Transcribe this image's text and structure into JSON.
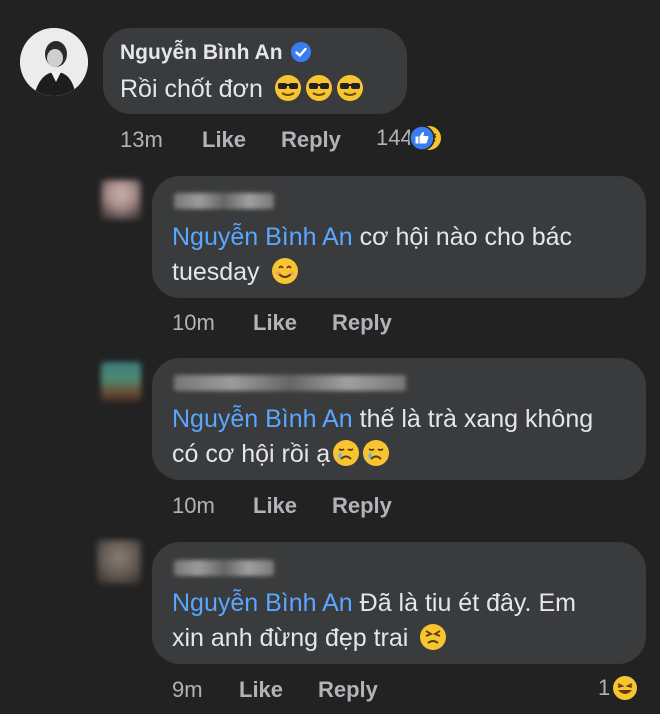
{
  "comment_main": {
    "author": "Nguyễn Bình An",
    "text": "Rồi chốt đơn",
    "time": "13m",
    "like_label": "Like",
    "reply_label": "Reply",
    "reaction_count": "144",
    "reaction_icons": [
      "laugh-emoji-icon",
      "like-thumb-icon"
    ],
    "emoji_icons": [
      "sunglasses-emoji-icon",
      "sunglasses-emoji-icon",
      "sunglasses-emoji-icon"
    ]
  },
  "replies": [
    {
      "mention": "Nguyễn Bình An",
      "text_line1": " cơ hội nào cho bác",
      "text_line2": "tuesday",
      "emoji_icons": [
        "smile-emoji-icon"
      ],
      "time": "10m",
      "like_label": "Like",
      "reply_label": "Reply"
    },
    {
      "mention": "Nguyễn Bình An",
      "text_line1": " thế là trà xang không",
      "text_line2": "có cơ hội rồi ạ",
      "emoji_icons": [
        "crying-emoji-icon",
        "crying-emoji-icon"
      ],
      "time": "10m",
      "like_label": "Like",
      "reply_label": "Reply"
    },
    {
      "mention": "Nguyễn Bình An",
      "text_line1": " Đã là tiu ét đây. Em",
      "text_line2": "xin anh đừng đẹp trai",
      "emoji_icons": [
        "tired-face-emoji-icon"
      ],
      "time": "9m",
      "like_label": "Like",
      "reply_label": "Reply",
      "reaction_count": "1",
      "reaction_icons": [
        "laugh-emoji-icon"
      ]
    }
  ],
  "colors": {
    "background": "#222222",
    "bubble": "#3a3b3c",
    "mention": "#5aa7ff",
    "meta": "#b0b3b8",
    "verified": "#3a7df2"
  }
}
